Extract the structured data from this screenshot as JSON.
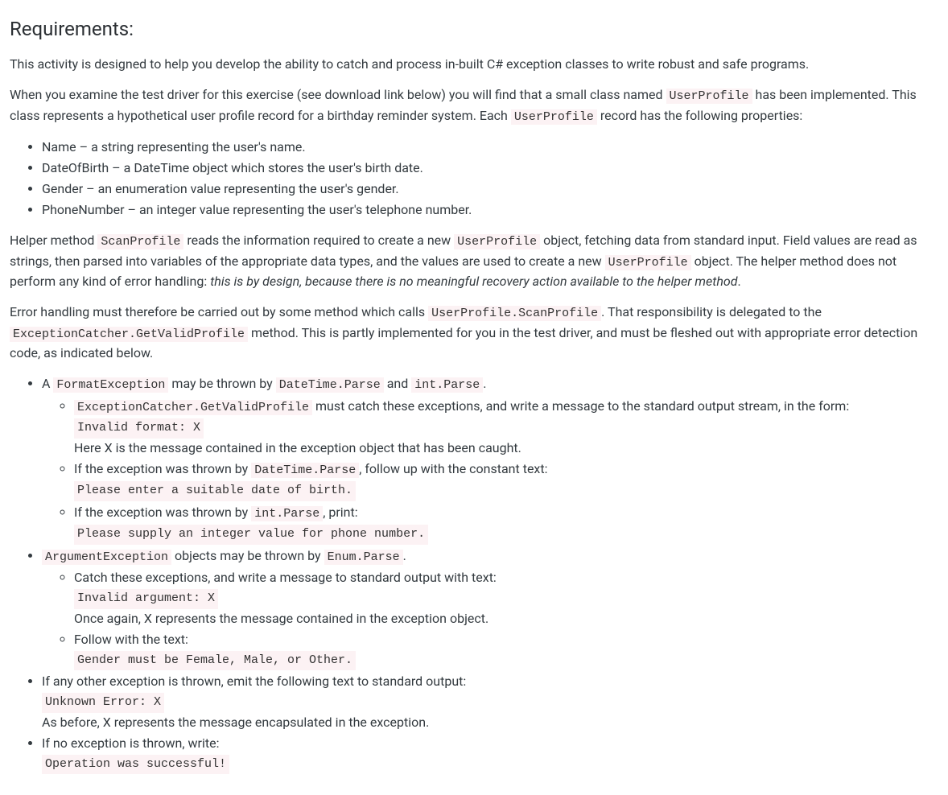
{
  "heading": "Requirements:",
  "intro": "This activity is designed to help you develop the ability to catch and process in-built C# exception classes to write robust and safe programs.",
  "p2": {
    "t1": "When you examine the test driver for this exercise (see download link below) you will find that a small class named ",
    "c1": "UserProfile",
    "t2": " has been implemented. This class represents a hypothetical user profile record for a birthday reminder system. Each ",
    "c2": "UserProfile",
    "t3": " record has the following properties:"
  },
  "props": {
    "i1": "Name – a string representing the user's name.",
    "i2": "DateOfBirth – a DateTime object which stores the user's birth date.",
    "i3": "Gender – an enumeration value representing the user's gender.",
    "i4": "PhoneNumber – an integer value representing the user's telephone number."
  },
  "p3": {
    "t1": "Helper method ",
    "c1": "ScanProfile",
    "t2": " reads the information required to create a new ",
    "c2": "UserProfile",
    "t3": " object, fetching data from standard input. Field values are read as strings, then parsed into variables of the appropriate data types, and the values are used to create a new ",
    "c3": "UserProfile",
    "t4": " object. The helper method does not perform any kind of error handling: ",
    "em": "this is by design, because there is no meaningful recovery action available to the helper method",
    "t5": "."
  },
  "p4": {
    "t1": "Error handling must therefore be carried out by some method which calls ",
    "c1": "UserProfile.ScanProfile",
    "t2": ". That responsibility is delegated to the ",
    "c2": "ExceptionCatcher.GetValidProfile",
    "t3": " method. This is partly implemented for you in the test driver, and must be fleshed out with appropriate error detection code, as indicated below."
  },
  "list2": {
    "i1": {
      "t1": "A ",
      "c1": "FormatException",
      "t2": " may be thrown by ",
      "c2": "DateTime.Parse",
      "t3": " and ",
      "c3": "int.Parse",
      "t4": ".",
      "sub1": {
        "c1": "ExceptionCatcher.GetValidProfile",
        "t1": " must catch these exceptions, and write a message to the standard output stream, in the form:",
        "code": "Invalid format: X",
        "t2": "Here X is the message contained in the exception object that has been caught."
      },
      "sub2": {
        "t1": "If the exception was thrown by ",
        "c1": "DateTime.Parse",
        "t2": ", follow up with the constant text:",
        "code": "Please enter a suitable date of birth."
      },
      "sub3": {
        "t1": "If the exception was thrown by ",
        "c1": "int.Parse",
        "t2": ", print:",
        "code": "Please supply an integer value for phone number."
      }
    },
    "i2": {
      "c1": "ArgumentException",
      "t1": " objects may be thrown by ",
      "c2": "Enum.Parse",
      "t2": ".",
      "sub1": {
        "t1": "Catch these exceptions, and write a message to standard output with text:",
        "code": "Invalid argument: X",
        "t2": "Once again, X represents the message contained in the exception object."
      },
      "sub2": {
        "t1": "Follow with the text:",
        "code": "Gender must be Female, Male, or Other."
      }
    },
    "i3": {
      "t1": "If any other exception is thrown, emit the following text to standard output:",
      "code": "Unknown Error: X",
      "t2": "As before, X represents the message encapsulated in the exception."
    },
    "i4": {
      "t1": "If no exception is thrown, write:",
      "code": "Operation was successful!"
    }
  }
}
